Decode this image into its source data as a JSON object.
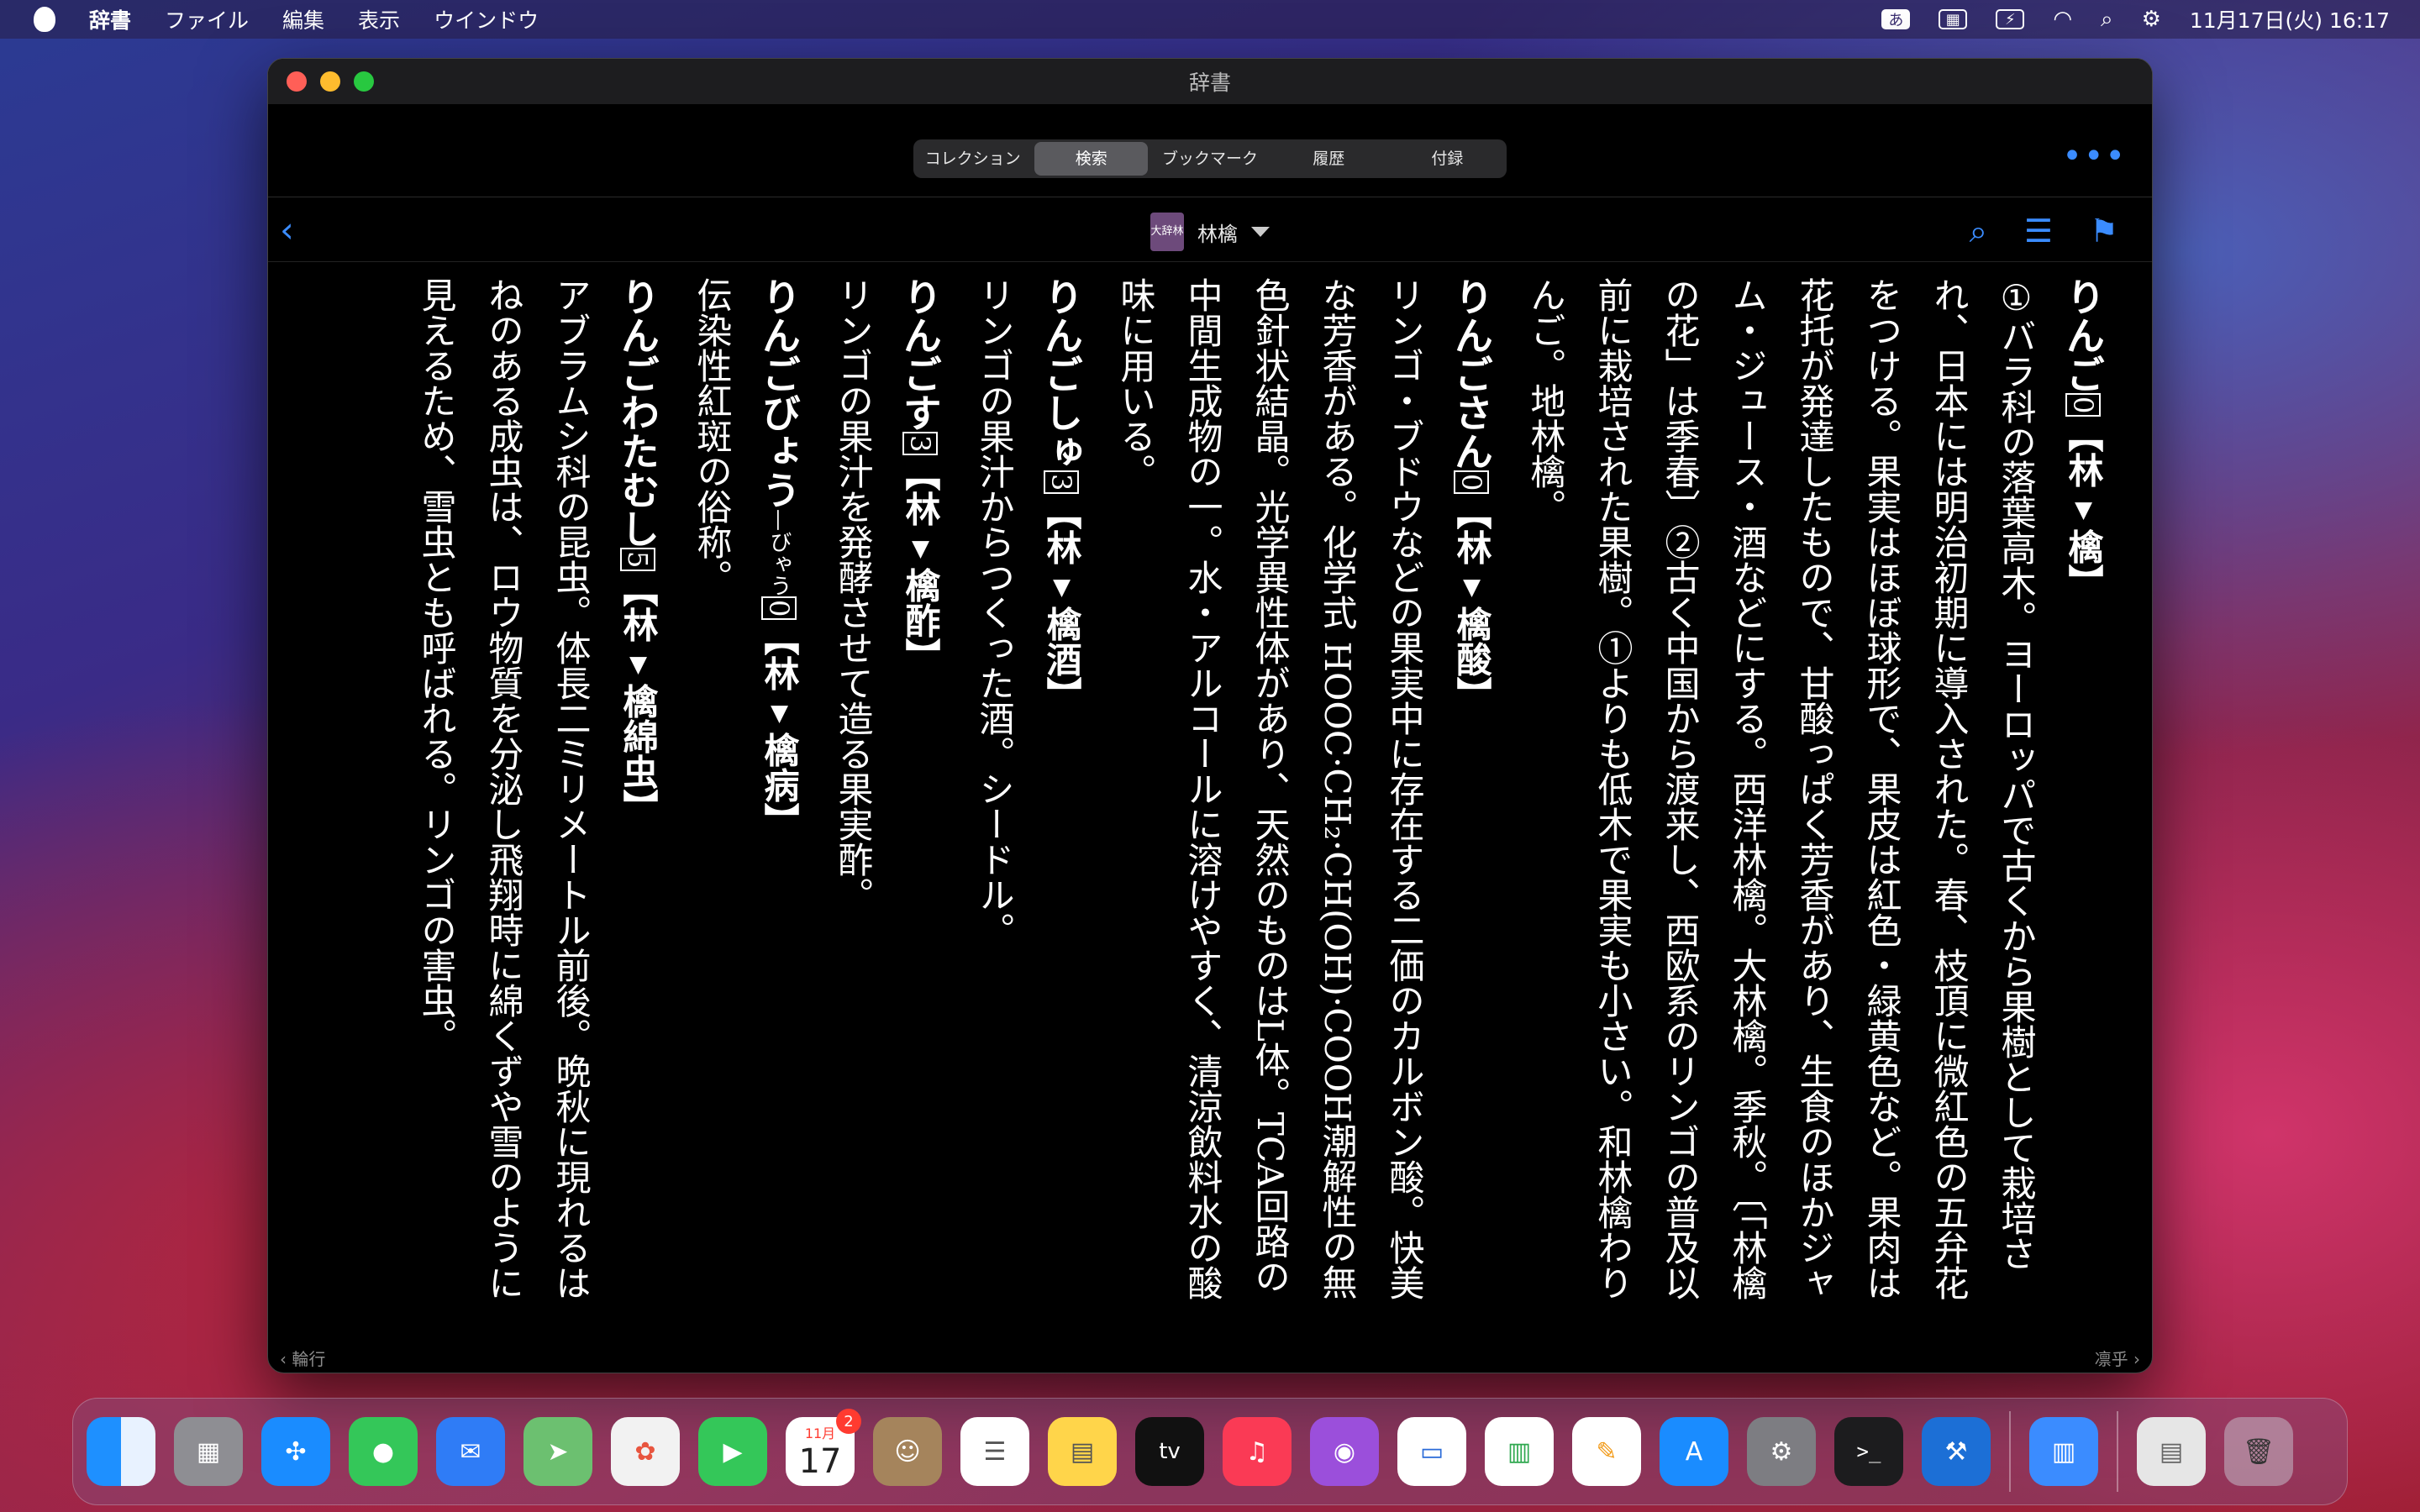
{
  "menubar": {
    "app_name": "辞書",
    "items": [
      "ファイル",
      "編集",
      "表示",
      "ウインドウ"
    ],
    "input_method": "あ",
    "datetime": "11月17日(火) 16:17"
  },
  "window": {
    "title": "辞書",
    "tabs": [
      "コレクション",
      "検索",
      "ブックマーク",
      "履歴",
      "付録"
    ],
    "active_tab": "検索",
    "more_label": "•••",
    "back_label": "‹",
    "dictionary_badge": "大辞林",
    "headword": "林檎",
    "footer_prev": "‹ 輪行",
    "footer_next": "凛乎 ›"
  },
  "entries": [
    {
      "head": "りんご",
      "accent": "0",
      "kanji": "【林▾檎】",
      "body": "①バラ科の落葉高木。ヨーロッパで古くから果樹として栽培され、日本には明治初期に導入された。春、枝頂に微紅色の五弁花をつける。果実はほぼ球形で、果皮は紅色・緑黄色など。果肉は花托が発達したもので、甘酸っぱく芳香があり、生食のほかジャム・ジュース・酒などにする。西洋林檎。大林檎。季秋。〔「林檎の花」は季春〕②古く中国から渡来し、西欧系のリンゴの普及以前に栽培された果樹。①よりも低木で果実も小さい。和林檎わりんご。地林檎。"
    },
    {
      "head": "りんごさん",
      "accent": "0",
      "kanji": "【林▾檎酸】",
      "body": "リンゴ・ブドウなどの果実中に存在する二価のカルボン酸。快美な芳香がある。化学式 HOOC·CH₂·CH(OH)·COOH潮解性の無色針状結晶。光学異性体があり、天然のものはL体。TCA回路の中間生成物の一。水・アルコールに溶けやすく、清涼飲料水の酸味に用いる。"
    },
    {
      "head": "りんごしゅ",
      "accent": "3",
      "kanji": "【林▾檎酒】",
      "body": "リンゴの果汁からつくった酒。シードル。"
    },
    {
      "head": "りんごす",
      "accent": "3",
      "kanji": "【林▾檎酢】",
      "body": "リンゴの果汁を発酵させて造る果実酢。"
    },
    {
      "head": "りんごびょう",
      "reading": "—びゃう",
      "accent": "0",
      "kanji": "【林▾檎病】",
      "body": "伝染性紅斑の俗称。"
    },
    {
      "head": "りんごわたむし",
      "accent": "5",
      "kanji": "【林▾檎綿虫】",
      "body": "アブラムシ科の昆虫。体長二ミリメートル前後。晩秋に現れるはねのある成虫は、ロウ物質を分泌し飛翔時に綿くずや雪のように見えるため、雪虫とも呼ばれる。リンゴの害虫。"
    }
  ],
  "dock": {
    "calendar_month": "11月",
    "calendar_day": "17",
    "calendar_badge": "2",
    "tv_label": "tv"
  }
}
